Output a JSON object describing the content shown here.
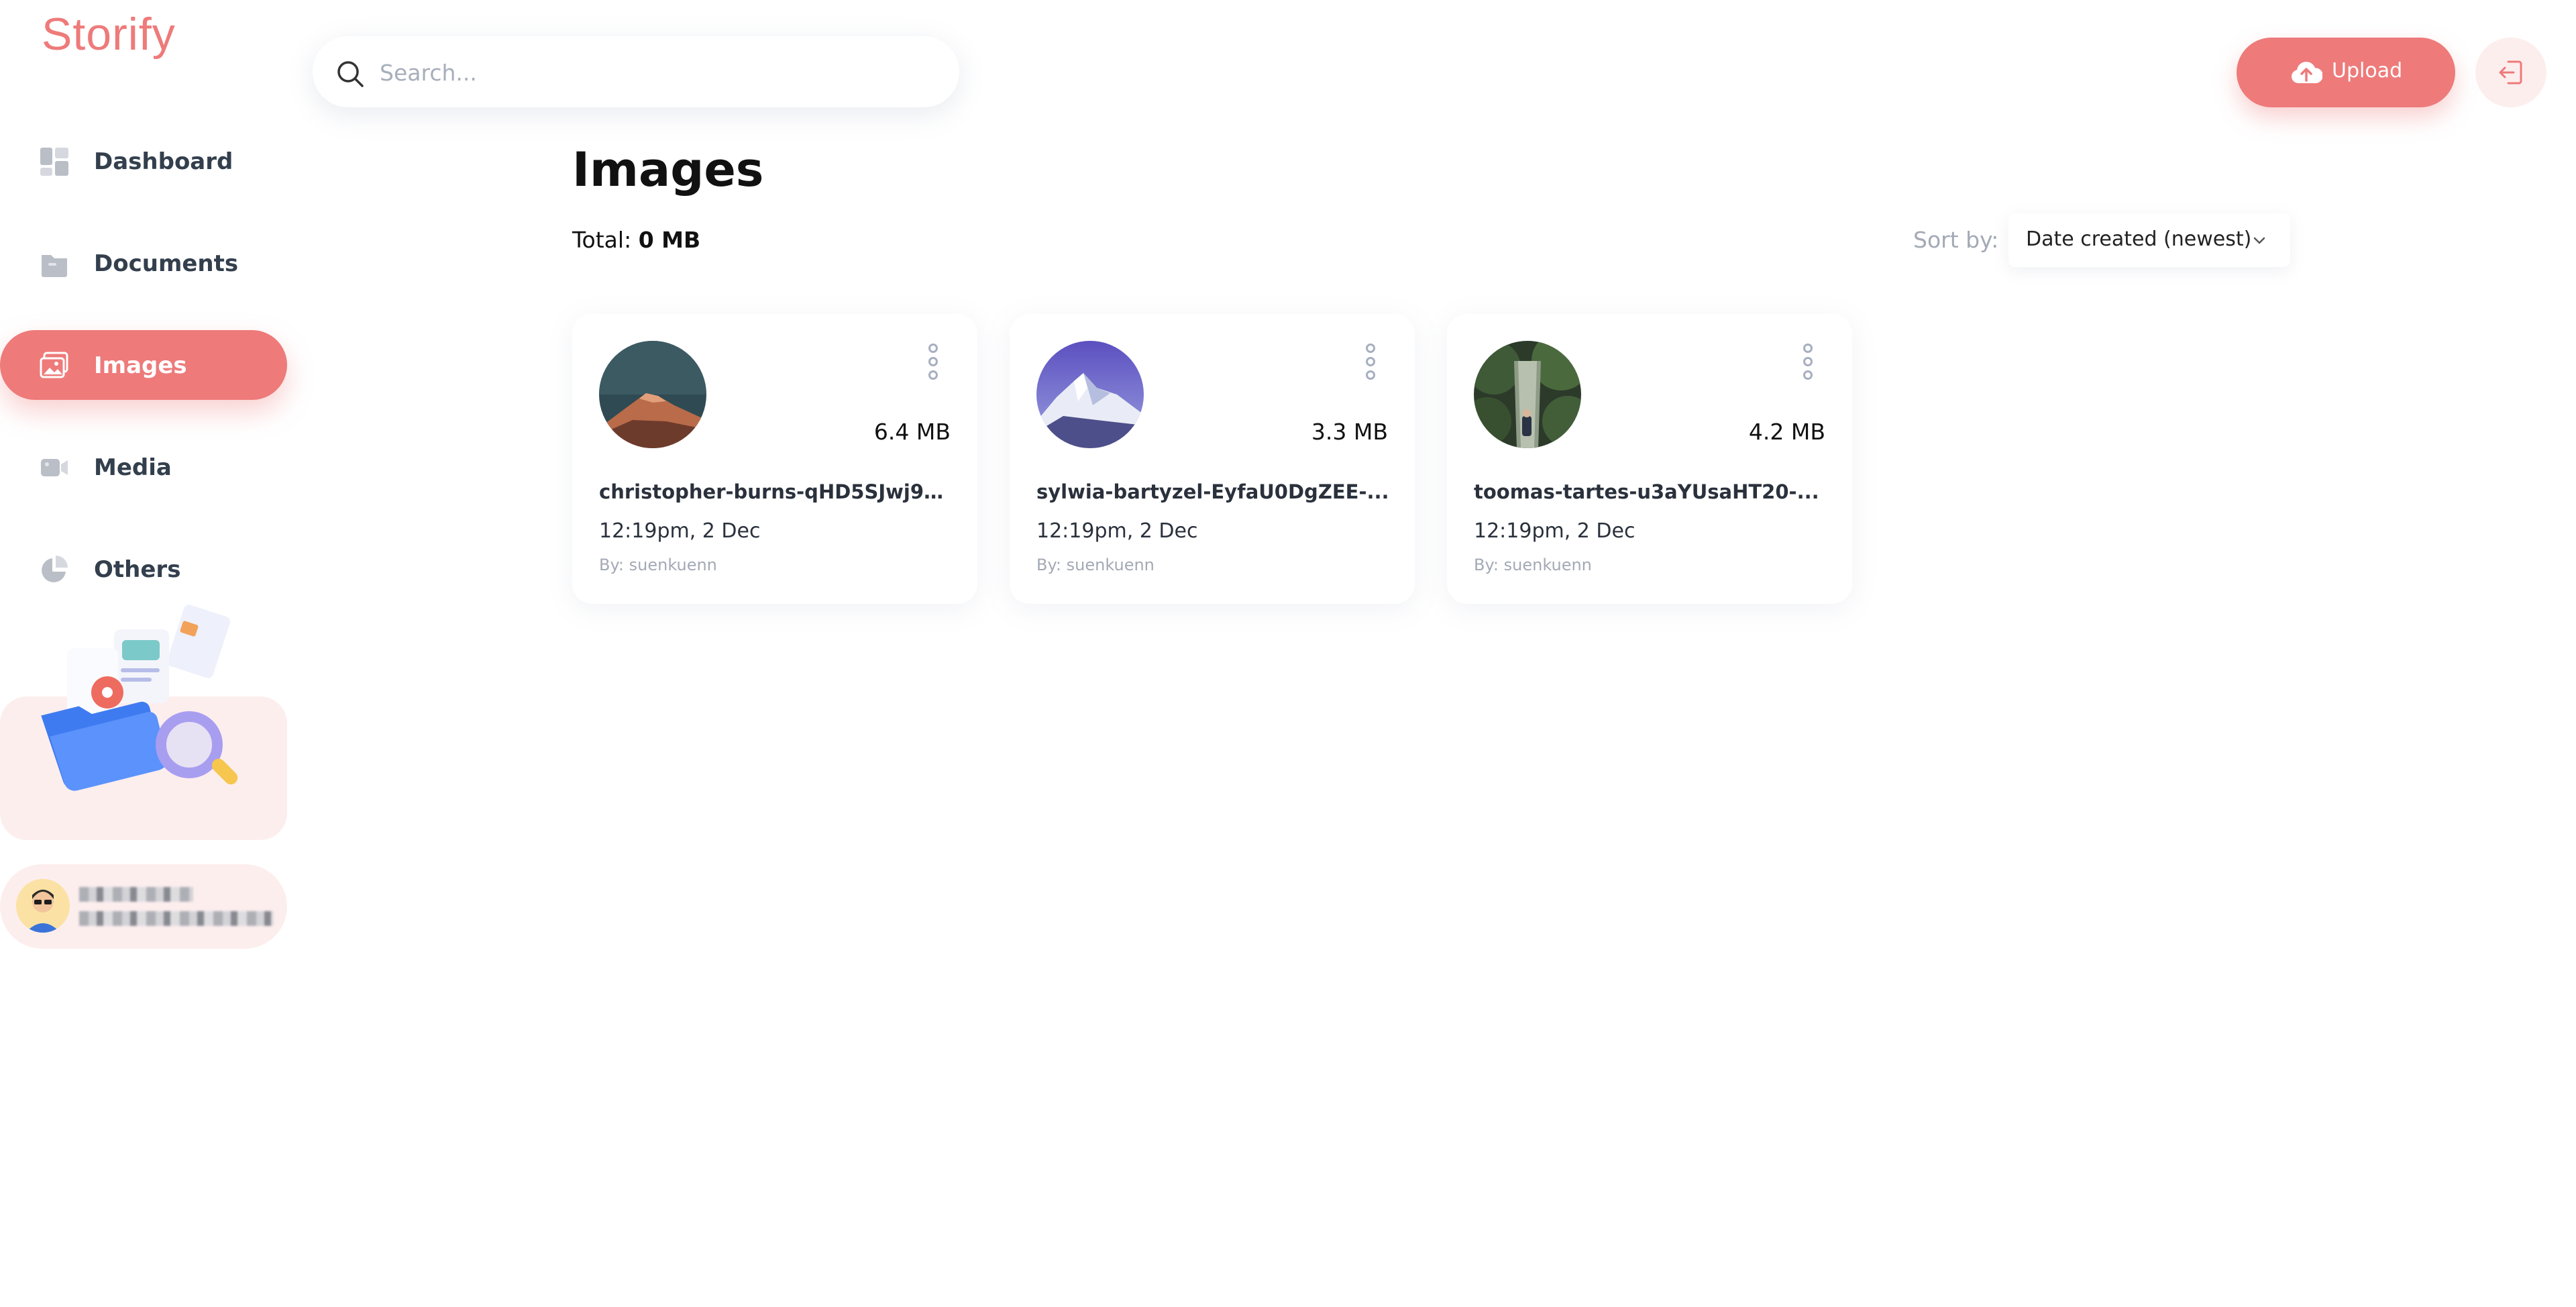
{
  "app": {
    "name": "Storify"
  },
  "sidebar": {
    "items": [
      {
        "label": "Dashboard",
        "icon": "dashboard-icon",
        "active": false
      },
      {
        "label": "Documents",
        "icon": "folder-icon",
        "active": false
      },
      {
        "label": "Images",
        "icon": "images-icon",
        "active": true
      },
      {
        "label": "Media",
        "icon": "video-icon",
        "active": false
      },
      {
        "label": "Others",
        "icon": "pie-chart-icon",
        "active": false
      }
    ]
  },
  "header": {
    "search_placeholder": "Search...",
    "upload_label": "Upload",
    "upload_icon": "cloud-upload-icon",
    "logout_icon": "logout-icon"
  },
  "main": {
    "title": "Images",
    "total_label": "Total:",
    "total_value": "0 MB",
    "sort_label": "Sort by:",
    "sort_value": "Date created (newest)",
    "files": [
      {
        "name": "christopher-burns-qHD5SJwj9gM-...",
        "size": "6.4 MB",
        "date": "12:19pm, 2 Dec",
        "owner": "By: suenkuenn"
      },
      {
        "name": "sylwia-bartyzel-EyfaU0DgZEE-...",
        "size": "3.3 MB",
        "date": "12:19pm, 2 Dec",
        "owner": "By: suenkuenn"
      },
      {
        "name": "toomas-tartes-u3aYUsaHT20-...",
        "size": "4.2 MB",
        "date": "12:19pm, 2 Dec",
        "owner": "By: suenkuenn"
      }
    ]
  },
  "colors": {
    "accent": "#ee7a7a",
    "accent_soft": "#fdeeee",
    "muted": "#a3a9b5"
  }
}
